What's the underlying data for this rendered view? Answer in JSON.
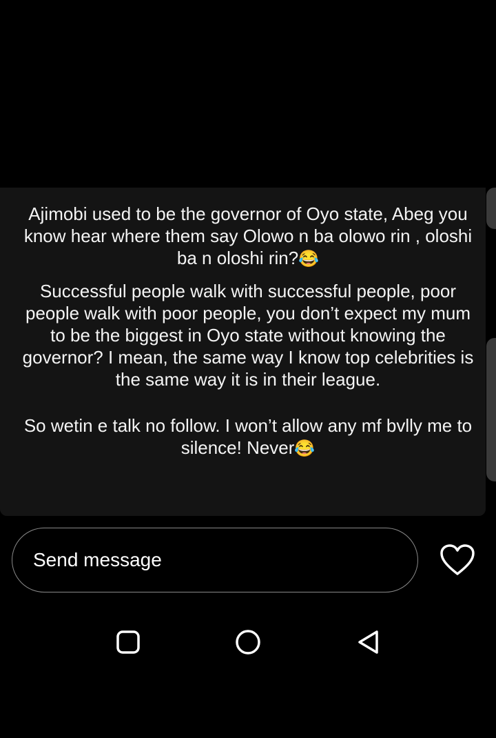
{
  "story": {
    "paragraphs": [
      {
        "text": "Ajimobi used to be the governor of Oyo state, Abeg you know hear where them say Olowo n ba olowo rin , oloshi ba n oloshi rin?",
        "emoji": "😂"
      },
      {
        "text": "Successful people walk with successful people, poor people walk with poor people, you don’t expect my mum to be the biggest in Oyo state without knowing the governor? I mean, the same way I know top celebrities is the same way it is in their league.",
        "emoji": ""
      },
      {
        "text": "So wetin e talk no follow. I won’t allow any mf bvlly me to silence! Never",
        "emoji": "😂"
      }
    ]
  },
  "reply": {
    "placeholder": "Send message",
    "like_icon": "heart-outline-icon"
  },
  "navigation": {
    "recents_icon": "rounded-square-icon",
    "home_icon": "circle-icon",
    "back_icon": "triangle-back-icon"
  },
  "colors": {
    "background": "#000000",
    "card": "#141414",
    "text": "#f4f4f4",
    "input_border": "#8a8a8a"
  }
}
